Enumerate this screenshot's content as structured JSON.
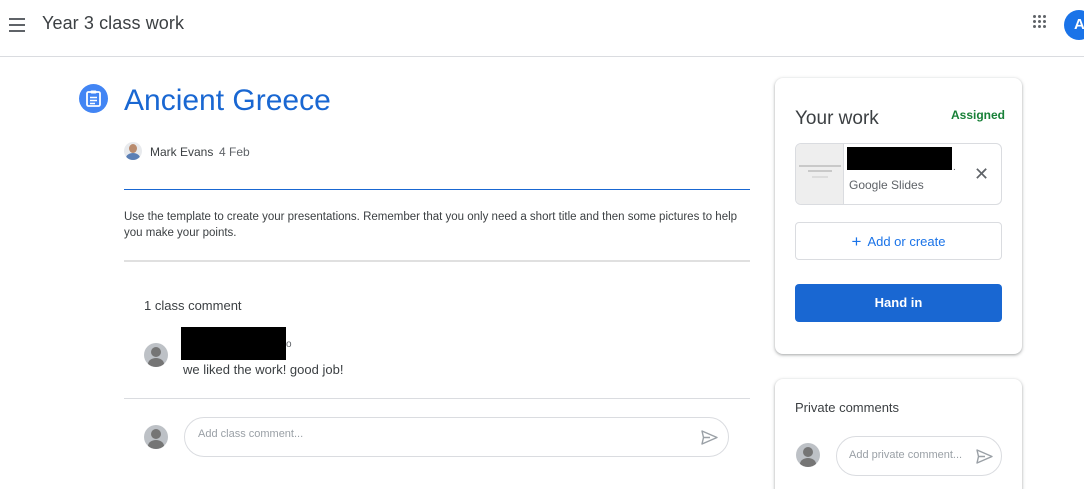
{
  "header": {
    "class_title": "Year 3 class work",
    "menu_icon": "menu-icon",
    "apps_icon": "apps-grid-icon",
    "account_initial": "A",
    "account_color": "#1a73e8"
  },
  "assignment": {
    "icon": "assignment-icon",
    "title": "Ancient Greece",
    "teacher": "Mark Evans",
    "date": "4 Feb",
    "description": "Use the template to create your presentations. Remember that you only need a short title and then some pictures to help you make your points.",
    "title_color": "#1967d2"
  },
  "class_comments": {
    "header": "1 class comment",
    "comments": [
      {
        "author": "[redacted]",
        "trailing": "o",
        "text": "we liked the work! good job!"
      }
    ],
    "input_placeholder": "Add class comment..."
  },
  "your_work": {
    "title": "Your work",
    "status": "Assigned",
    "status_color": "#188038",
    "attachment": {
      "name": "[redacted]",
      "trailing": ".",
      "type": "Google Slides"
    },
    "add_label": "Add or create",
    "hand_in_label": "Hand in",
    "button_color": "#1967d2"
  },
  "private_comments": {
    "title": "Private comments",
    "input_placeholder": "Add private comment..."
  }
}
